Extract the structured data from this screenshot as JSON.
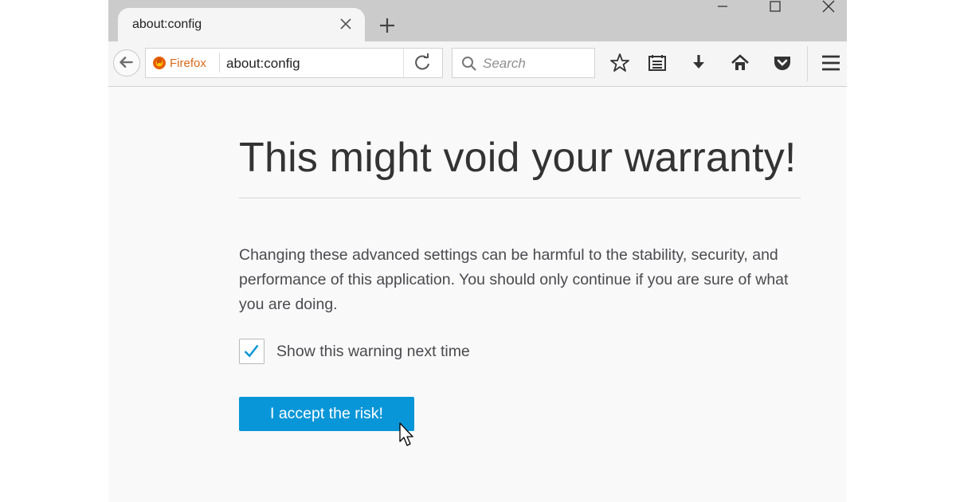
{
  "tab": {
    "title": "about:config",
    "close_icon": "close-icon"
  },
  "navbar": {
    "identity_label": "Firefox",
    "url": "about:config",
    "search_placeholder": "Search",
    "icons": [
      "back-arrow-icon",
      "firefox-icon",
      "reload-icon",
      "search-icon",
      "bookmark-star-icon",
      "reading-list-icon",
      "download-icon",
      "home-icon",
      "pocket-icon",
      "hamburger-menu-icon"
    ]
  },
  "content": {
    "title": "This might void your warranty!",
    "description": "Changing these advanced settings can be harmful to the stability, security, and performance of this application. You should only continue if you are sure of what you are doing.",
    "checkbox_label": "Show this warning next time",
    "checkbox_checked": true,
    "accept_button": "I accept the risk!"
  },
  "colors": {
    "accent": "#0996d8",
    "firefox_orange": "#d86a1a",
    "check": "#0996d8"
  }
}
